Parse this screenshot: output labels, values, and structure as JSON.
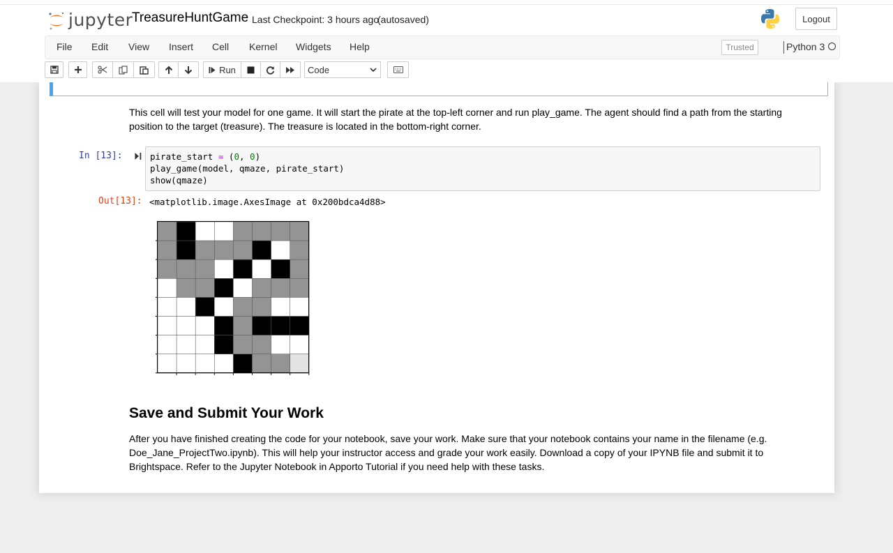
{
  "header": {
    "logo_text": "jupyter",
    "notebook_name": "TreasureHuntGame",
    "checkpoint": "Last Checkpoint: 3 hours ago",
    "autosave": "(autosaved)",
    "logout_label": "Logout"
  },
  "menubar": {
    "items": [
      "File",
      "Edit",
      "View",
      "Insert",
      "Cell",
      "Kernel",
      "Widgets",
      "Help"
    ],
    "trusted_label": "Trusted",
    "kernel_name": "Python 3"
  },
  "toolbar": {
    "run_label": "Run",
    "cell_type": "Code",
    "icons": [
      "save-icon",
      "add-cell-icon",
      "cut-icon",
      "copy-icon",
      "paste-icon",
      "move-up-icon",
      "move-down-icon",
      "run-icon",
      "stop-icon",
      "restart-icon",
      "fast-forward-icon",
      "keyboard-icon"
    ]
  },
  "cells": {
    "md_intro": "This cell will test your model for one game. It will start the pirate at the top-left corner and run play_game. The agent should find a path from the starting position to the target (treasure). The treasure is located in the bottom-right corner.",
    "in_prompt": "In [13]:",
    "code_lines": [
      "pirate_start = (0, 0)",
      "play_game(model, qmaze, pirate_start)",
      "show(qmaze)"
    ],
    "out_prompt": "Out[13]:",
    "out_text": "<matplotlib.image.AxesImage at 0x200bdca4d88>",
    "maze": {
      "legend": "0=white free, 1=black wall, 2=gray visited, 3=light target",
      "grid": [
        [
          2,
          1,
          0,
          0,
          2,
          2,
          2,
          2
        ],
        [
          2,
          1,
          2,
          2,
          2,
          1,
          0,
          2
        ],
        [
          2,
          2,
          2,
          0,
          1,
          0,
          1,
          2
        ],
        [
          0,
          2,
          2,
          1,
          0,
          2,
          2,
          2
        ],
        [
          0,
          0,
          1,
          0,
          2,
          2,
          0,
          0
        ],
        [
          0,
          0,
          0,
          1,
          2,
          1,
          1,
          1
        ],
        [
          0,
          0,
          0,
          1,
          2,
          2,
          0,
          0
        ],
        [
          0,
          0,
          0,
          0,
          1,
          2,
          2,
          3
        ]
      ],
      "colors": {
        "free": "#ffffff",
        "wall": "#000000",
        "visited": "#949494",
        "target": "#e3e3e3"
      }
    },
    "heading": "Save and Submit Your Work",
    "md_submit": "After you have finished creating the code for your notebook, save your work. Make sure that your notebook contains your name in the filename (e.g. Doe_Jane_ProjectTwo.ipynb). This will help your instructor access and grade your work easily. Download a copy of your IPYNB file and submit it to Brightspace. Refer to the Jupyter Notebook in Apporto Tutorial if you need help with these tasks."
  }
}
